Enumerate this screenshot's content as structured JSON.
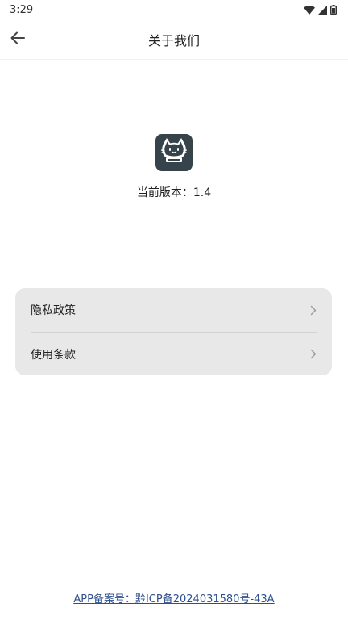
{
  "status_bar": {
    "time": "3:29",
    "icons": [
      "wifi-icon",
      "signal-icon",
      "battery-icon"
    ]
  },
  "header": {
    "title": "关于我们",
    "back_icon": "arrow-left-icon"
  },
  "about": {
    "logo_icon": "cat-logo-icon",
    "version_label": "当前版本：1.4"
  },
  "menu": {
    "items": [
      {
        "label": "隐私政策",
        "icon": "chevron-right-icon"
      },
      {
        "label": "使用条款",
        "icon": "chevron-right-icon"
      }
    ]
  },
  "footer": {
    "icp": "APP备案号：黔ICP备2024031580号-43A"
  },
  "colors": {
    "logo_bg": "#37434a",
    "card_bg": "#e8e8e8",
    "link": "#2d4f8e"
  }
}
